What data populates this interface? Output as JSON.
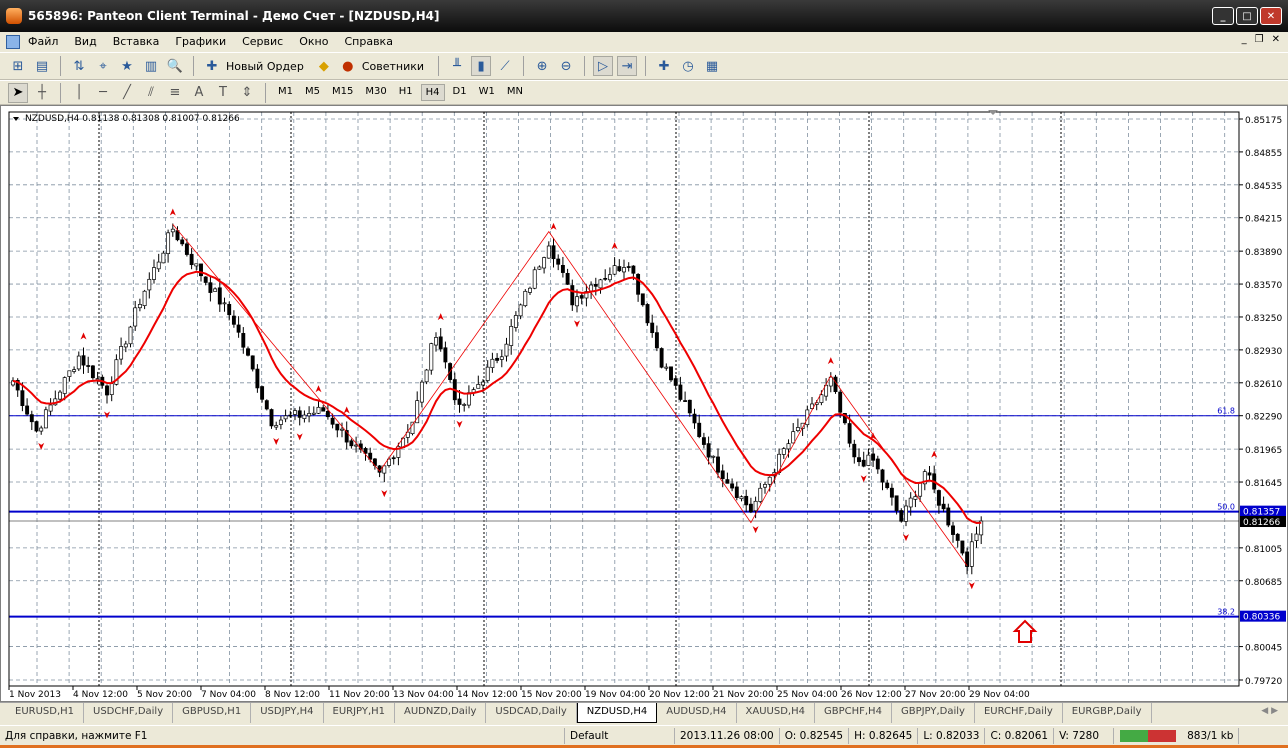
{
  "window": {
    "title": "565896: Panteon Client Terminal - Демо Счет - [NZDUSD,H4]"
  },
  "menu": [
    "Файл",
    "Вид",
    "Вставка",
    "Графики",
    "Сервис",
    "Окно",
    "Справка"
  ],
  "toolbar": {
    "new_order": "Новый Ордер",
    "advisors": "Советники"
  },
  "timeframes": [
    "M1",
    "M5",
    "M15",
    "M30",
    "H1",
    "H4",
    "D1",
    "W1",
    "MN"
  ],
  "active_timeframe": "H4",
  "chart": {
    "header": "NZDUSD,H4  0.81138 0.81308 0.81007 0.81266",
    "price_ticks": [
      "0.85175",
      "0.84855",
      "0.84535",
      "0.84215",
      "0.83890",
      "0.83570",
      "0.83250",
      "0.82930",
      "0.82610",
      "0.82290",
      "0.81965",
      "0.81645",
      "0.81005",
      "0.80685",
      "0.80045",
      "0.79720"
    ],
    "price_range": [
      0.7972,
      0.85175
    ],
    "date_ticks": [
      "1 Nov 2013",
      "4 Nov 12:00",
      "5 Nov 20:00",
      "7 Nov 04:00",
      "8 Nov 12:00",
      "11 Nov 20:00",
      "13 Nov 04:00",
      "14 Nov 12:00",
      "15 Nov 20:00",
      "19 Nov 04:00",
      "20 Nov 12:00",
      "21 Nov 20:00",
      "25 Nov 04:00",
      "26 Nov 12:00",
      "27 Nov 20:00",
      "29 Nov 04:00"
    ],
    "fib_levels": [
      {
        "label": "61.8",
        "price": 0.8229
      },
      {
        "label": "50.0",
        "price": 0.81357,
        "tag": "0.81357"
      },
      {
        "label": "38.2",
        "price": 0.80336,
        "tag": "0.80336"
      }
    ],
    "current_price": "0.81266",
    "bars": 207,
    "path": [
      [
        0,
        0.8263
      ],
      [
        5,
        0.8214
      ],
      [
        14,
        0.8287
      ],
      [
        20,
        0.8253
      ],
      [
        27,
        0.8341
      ],
      [
        34,
        0.8411
      ],
      [
        38,
        0.838
      ],
      [
        47,
        0.8321
      ],
      [
        55,
        0.8224
      ],
      [
        66,
        0.8234
      ],
      [
        78,
        0.8171
      ],
      [
        85,
        0.8224
      ],
      [
        90,
        0.8311
      ],
      [
        95,
        0.8234
      ],
      [
        104,
        0.8292
      ],
      [
        114,
        0.8399
      ],
      [
        119,
        0.8341
      ],
      [
        124,
        0.836
      ],
      [
        131,
        0.838
      ],
      [
        138,
        0.8282
      ],
      [
        149,
        0.8185
      ],
      [
        157,
        0.8137
      ],
      [
        164,
        0.8195
      ],
      [
        174,
        0.8263
      ],
      [
        179,
        0.8185
      ],
      [
        183,
        0.8185
      ],
      [
        189,
        0.8127
      ],
      [
        194,
        0.8175
      ],
      [
        203,
        0.8088
      ],
      [
        206,
        0.81266
      ]
    ],
    "zigzag": [
      [
        34,
        0.8415
      ],
      [
        78,
        0.8175
      ],
      [
        114,
        0.8408
      ],
      [
        157,
        0.8125
      ],
      [
        174,
        0.8268
      ],
      [
        203,
        0.8083
      ]
    ],
    "colors": {
      "bull": "#ffffff",
      "bear": "#000000",
      "ma": "#ee0000",
      "zigzag": "#ee0000",
      "fib": "#0000cc",
      "grid": "#8090a0"
    }
  },
  "tabs": [
    "EURUSD,H1",
    "USDCHF,Daily",
    "GBPUSD,H1",
    "USDJPY,H4",
    "EURJPY,H1",
    "AUDNZD,Daily",
    "USDCAD,Daily",
    "NZDUSD,H4",
    "AUDUSD,H4",
    "XAUUSD,H4",
    "GBPCHF,H4",
    "GBPJPY,Daily",
    "EURCHF,Daily",
    "EURGBP,Daily"
  ],
  "active_tab": "NZDUSD,H4",
  "status": {
    "help": "Для справки, нажмите F1",
    "profile": "Default",
    "time": "2013.11.26 08:00",
    "open": "O: 0.82545",
    "high": "H: 0.82645",
    "low": "L: 0.82033",
    "close": "C: 0.82061",
    "volume": "V: 7280",
    "traffic": "883/1 kb"
  }
}
